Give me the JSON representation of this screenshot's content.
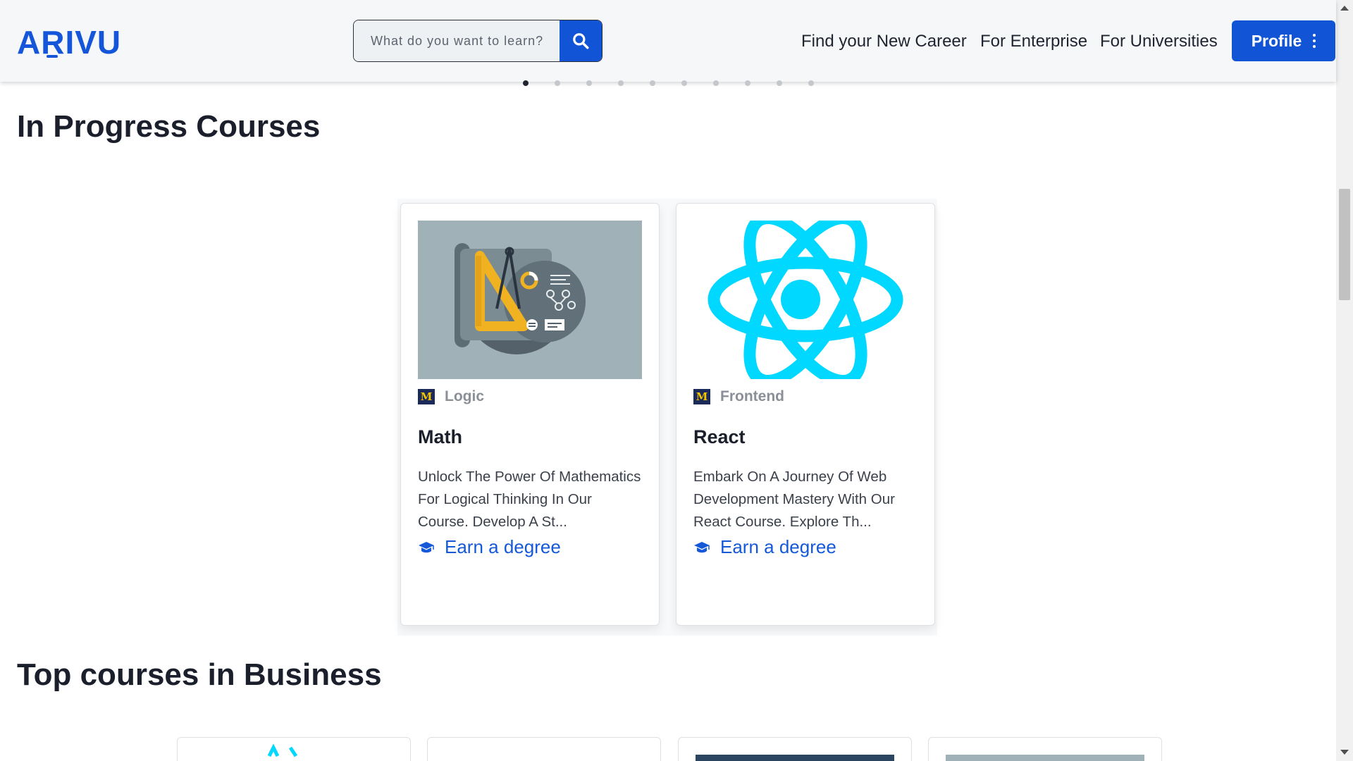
{
  "header": {
    "logo": "ARIVU",
    "search": {
      "placeholder": "What do you want to learn?",
      "value": ""
    },
    "nav": [
      {
        "label": "Find your New Career"
      },
      {
        "label": "For Enterprise"
      },
      {
        "label": "For Universities"
      }
    ],
    "profile_label": "Profile"
  },
  "carousel": {
    "dot_count": 10,
    "active_index": 0
  },
  "in_progress": {
    "title": "In Progress Courses",
    "courses": [
      {
        "category": "Logic",
        "title": "Math",
        "description": "Unlock The Power Of Mathematics For Logical Thinking In Our Course. Develop A St...",
        "link": "Earn a degree",
        "university_logo": "M"
      },
      {
        "category": "Frontend",
        "title": "React",
        "description": "Embark On A Journey Of Web Development Mastery With Our React Course. Explore Th...",
        "link": "Earn a degree",
        "university_logo": "M"
      }
    ]
  },
  "top_business": {
    "title": "Top courses in Business"
  },
  "colors": {
    "brand": "#1155d6",
    "react": "#00d8ff",
    "math_bg": "#a1b1b8"
  }
}
